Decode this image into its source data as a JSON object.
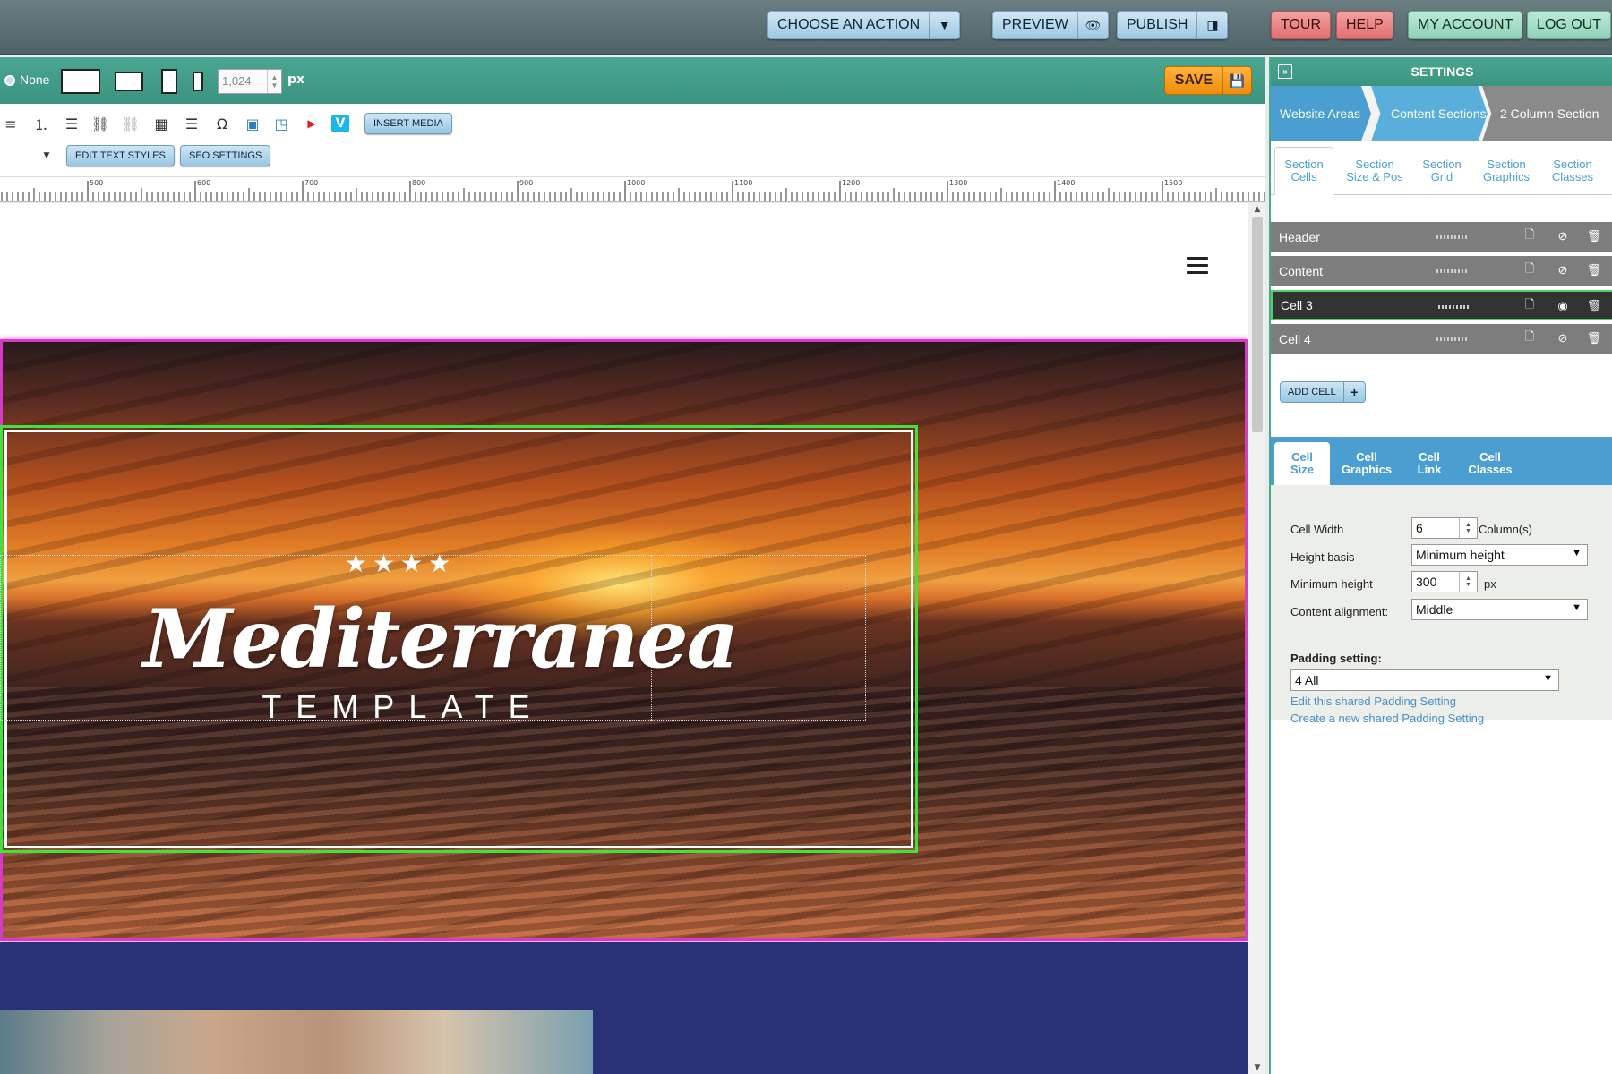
{
  "topbar": {
    "choose_action": "CHOOSE AN ACTION",
    "preview": "PREVIEW",
    "publish": "PUBLISH",
    "tour": "TOUR",
    "help": "HELP",
    "my_account": "MY ACCOUNT",
    "log_out": "LOG OUT"
  },
  "editor_bar": {
    "none_label": "None",
    "width_value": "1,024",
    "unit": "px",
    "save": "SAVE"
  },
  "format_bar": {
    "insert_media": "INSERT MEDIA",
    "edit_text_styles": "EDIT TEXT STYLES",
    "seo_settings": "SEO SETTINGS"
  },
  "ruler": {
    "ticks": [
      "500",
      "600",
      "700",
      "800",
      "900",
      "1000",
      "1100",
      "1200",
      "1300",
      "1400",
      "1500"
    ]
  },
  "canvas": {
    "stars": "★★★★",
    "title": "Mediterranea",
    "subtitle": "TEMPLATE"
  },
  "panel": {
    "title": "SETTINGS",
    "breadcrumbs": [
      "Website Areas",
      "Content Sections",
      "2 Column Section"
    ],
    "section_tabs": [
      {
        "l1": "Section",
        "l2": "Cells"
      },
      {
        "l1": "Section",
        "l2": "Size & Pos"
      },
      {
        "l1": "Section",
        "l2": "Grid"
      },
      {
        "l1": "Section",
        "l2": "Graphics"
      },
      {
        "l1": "Section",
        "l2": "Classes"
      }
    ],
    "cells": [
      "Header",
      "Content",
      "Cell 3",
      "Cell 4"
    ],
    "add_cell": "ADD CELL",
    "cell_tabs": [
      {
        "l1": "Cell",
        "l2": "Size"
      },
      {
        "l1": "Cell",
        "l2": "Graphics"
      },
      {
        "l1": "Cell",
        "l2": "Link"
      },
      {
        "l1": "Cell",
        "l2": "Classes"
      }
    ],
    "form": {
      "cell_width_label": "Cell Width",
      "cell_width_value": "6",
      "columns_label": "Column(s)",
      "height_basis_label": "Height basis",
      "height_basis_value": "Minimum height",
      "min_height_label": "Minimum height",
      "min_height_value": "300",
      "min_height_unit": "px",
      "content_alignment_label": "Content alignment:",
      "content_alignment_value": "Middle",
      "padding_label": "Padding setting:",
      "padding_value": "4 All",
      "edit_link": "Edit this shared Padding Setting",
      "create_link": "Create a new shared Padding Setting"
    }
  },
  "colors": {
    "accent_green": "#4aa691",
    "panel_blue": "#4a9fd0",
    "save_orange": "#f08c08",
    "hero_border": "#d63bc8",
    "cell_outline": "#3ee33e",
    "section_navy": "#2a3177"
  }
}
